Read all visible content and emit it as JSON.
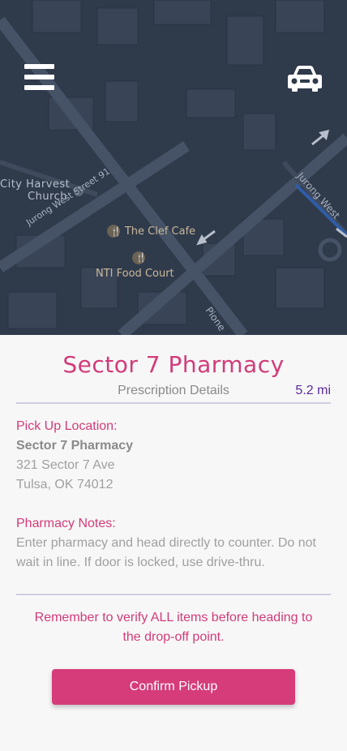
{
  "map": {
    "labels": {
      "city_harvest_line1": "City Harvest",
      "city_harvest_line2": "Church",
      "street_91": "Jurong West Street 91",
      "clef_cafe": "The Clef Cafe",
      "food_court": "NTI Food Court",
      "jurong_west": "Jurong West",
      "pioneer": "Pione"
    },
    "colors": {
      "background": "#2f3a4b",
      "roads": "#3d485a",
      "blocks": "#394456"
    }
  },
  "header": {
    "menu_icon": "hamburger-menu-icon",
    "car_icon": "car-icon"
  },
  "pharmacy": {
    "name": "Sector 7 Pharmacy",
    "subtitle": "Prescription Details",
    "distance": "5.2 mi"
  },
  "pickup": {
    "label": "Pick Up Location:",
    "name": "Sector 7 Pharmacy",
    "address_line1": "321 Sector 7 Ave",
    "address_line2": "Tulsa, OK 74012"
  },
  "notes": {
    "label": "Pharmacy Notes:",
    "text": "Enter pharmacy and head directly to counter. Do not wait in line. If door is locked, use drive-thru."
  },
  "reminder": "Remember to verify ALL items before heading to the drop-off point.",
  "confirm_button": "Confirm Pickup",
  "colors": {
    "accent": "#d23b79",
    "button": "#d63b7a",
    "distance": "#5a2a9a",
    "divider": "#cfcde0"
  }
}
